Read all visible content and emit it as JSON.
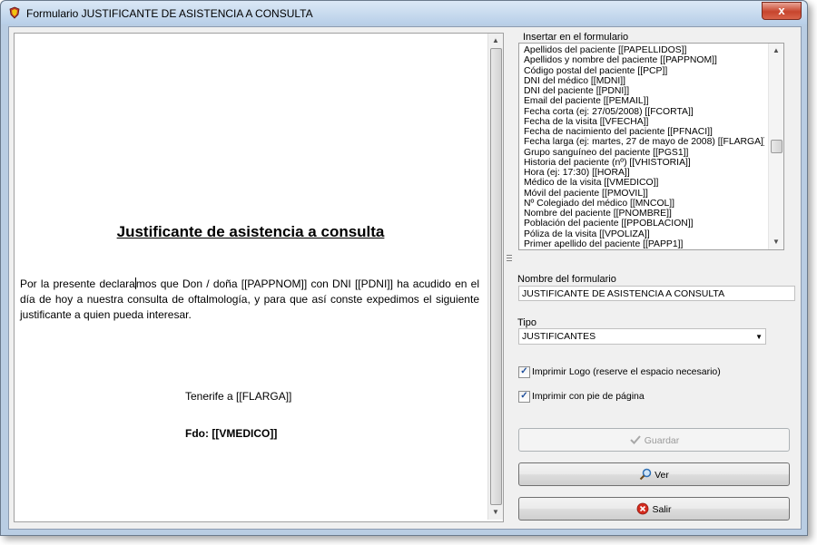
{
  "window": {
    "title": "Formulario JUSTIFICANTE DE ASISTENCIA A CONSULTA",
    "close_glyph": "x"
  },
  "document": {
    "title": "Justificante de asistencia a consulta",
    "body_before_caret": "Por la presente declara",
    "body_after_caret": "mos que Don / doña  [[PAPPNOM]] con DNI [[PDNI]] ha acudido en el día de hoy a nuestra consulta de oftalmología, y para que así conste expedimos el siguiente justificante a quien pueda interesar.",
    "place": "Tenerife a [[FLARGA]]",
    "signature": "Fdo: [[VMEDICO]]"
  },
  "insert": {
    "label": "Insertar en el formulario",
    "items": [
      "Apellidos del paciente   [[PAPELLIDOS]]",
      "Apellidos y nombre del paciente   [[PAPPNOM]]",
      "Código postal del paciente   [[PCP]]",
      "DNI del médico   [[MDNI]]",
      "DNI del paciente   [[PDNI]]",
      "Email del paciente   [[PEMAIL]]",
      "Fecha corta (ej: 27/05/2008)   [[FCORTA]]",
      "Fecha de la visita   [[VFECHA]]",
      "Fecha de nacimiento del paciente   [[PFNACI]]",
      "Fecha larga (ej: martes, 27 de mayo de 2008)   [[FLARGA]]",
      "Grupo sanguíneo del paciente   [[PGS1]]",
      "Historia del paciente (nº)   [[VHISTORIA]]",
      "Hora (ej: 17:30)   [[HORA]]",
      "Médico de la visita   [[VMEDICO]]",
      "Móvil del paciente   [[PMOVIL]]",
      "Nº Colegiado del médico   [[MNCOL]]",
      "Nombre del paciente   [[PNOMBRE]]",
      "Población del paciente   [[PPOBLACION]]",
      "Póliza de la visita   [[VPOLIZA]]",
      "Primer apellido del paciente   [[PAPP1]]"
    ]
  },
  "form_name": {
    "label": "Nombre del formulario",
    "value": "JUSTIFICANTE DE ASISTENCIA A CONSULTA"
  },
  "tipo": {
    "label": "Tipo",
    "value": "JUSTIFICANTES"
  },
  "options": {
    "print_logo": {
      "label": "Imprimir Logo (reserve el espacio necesario)",
      "checked": true
    },
    "print_footer": {
      "label": "Imprimir con pie de página",
      "checked": true
    }
  },
  "buttons": {
    "save": "Guardar",
    "view": "Ver",
    "exit": "Salir"
  },
  "colors": {
    "accent": "#1d4e9c",
    "exit_icon": "#d42b1e"
  }
}
